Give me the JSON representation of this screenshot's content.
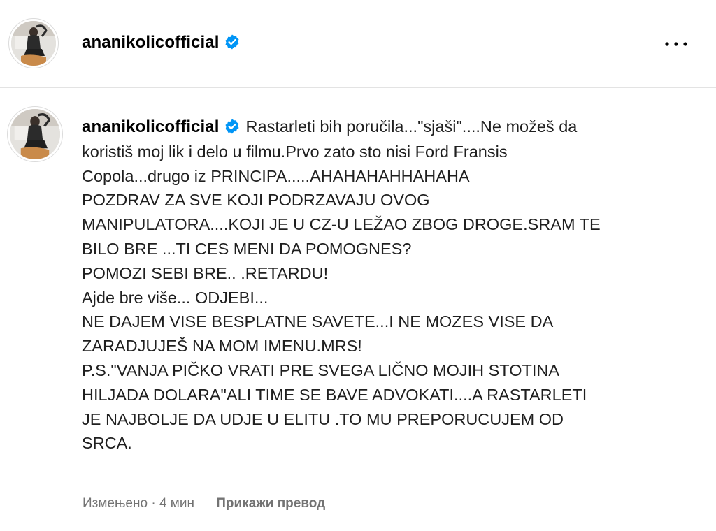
{
  "post_header": {
    "username": "ananikolicofficial",
    "verified_icon": "verified-badge-icon",
    "more_icon": "more-horizontal-icon"
  },
  "comment": {
    "username": "ananikolicofficial",
    "verified_icon": "verified-badge-icon",
    "first_line": "Rastarleti bih poručila...\"sjaši\"....Ne možeš da",
    "lines": [
      "koristiš moj lik i delo u filmu.Prvo zato sto nisi Ford Fransis",
      "Copola...drugo iz PRINCIPA.....AHAHAHAHHAHAHA",
      "POZDRAV ZA SVE KOJI PODRZAVAJU OVOG",
      "MANIPULATORA....KOJI JE U CZ-U LEŽAO ZBOG DROGE.SRAM TE",
      "BILO BRE ...TI CES MENI DA POMOGNES?",
      "POMOZI SEBI BRE.. .RETARDU!",
      "Ajde bre više... ODJEBI...",
      "NE DAJEM VISE BESPLATNE SAVETE...I NE MOZES VISE DA",
      "ZARADJUJEŠ NA MOM IMENU.MRS!",
      "P.S.\"VANJA PIČKO VRATI PRE SVEGA LIČNO MOJIH STOTINA",
      "HILJADA DOLARA\"ALI TIME SE BAVE ADVOKATI....A RASTARLETI",
      "JE NAJBOLJE DA UDJE U ELITU .TO MU PREPORUCUJEM OD",
      "SRCA."
    ],
    "edited_label": "Измењено",
    "separator": "·",
    "time_ago": "4 мин",
    "translate_label": "Прикажи превод"
  },
  "colors": {
    "verified_blue": "#0095f6",
    "muted_text": "#737373",
    "divider": "#e3e3e3"
  }
}
